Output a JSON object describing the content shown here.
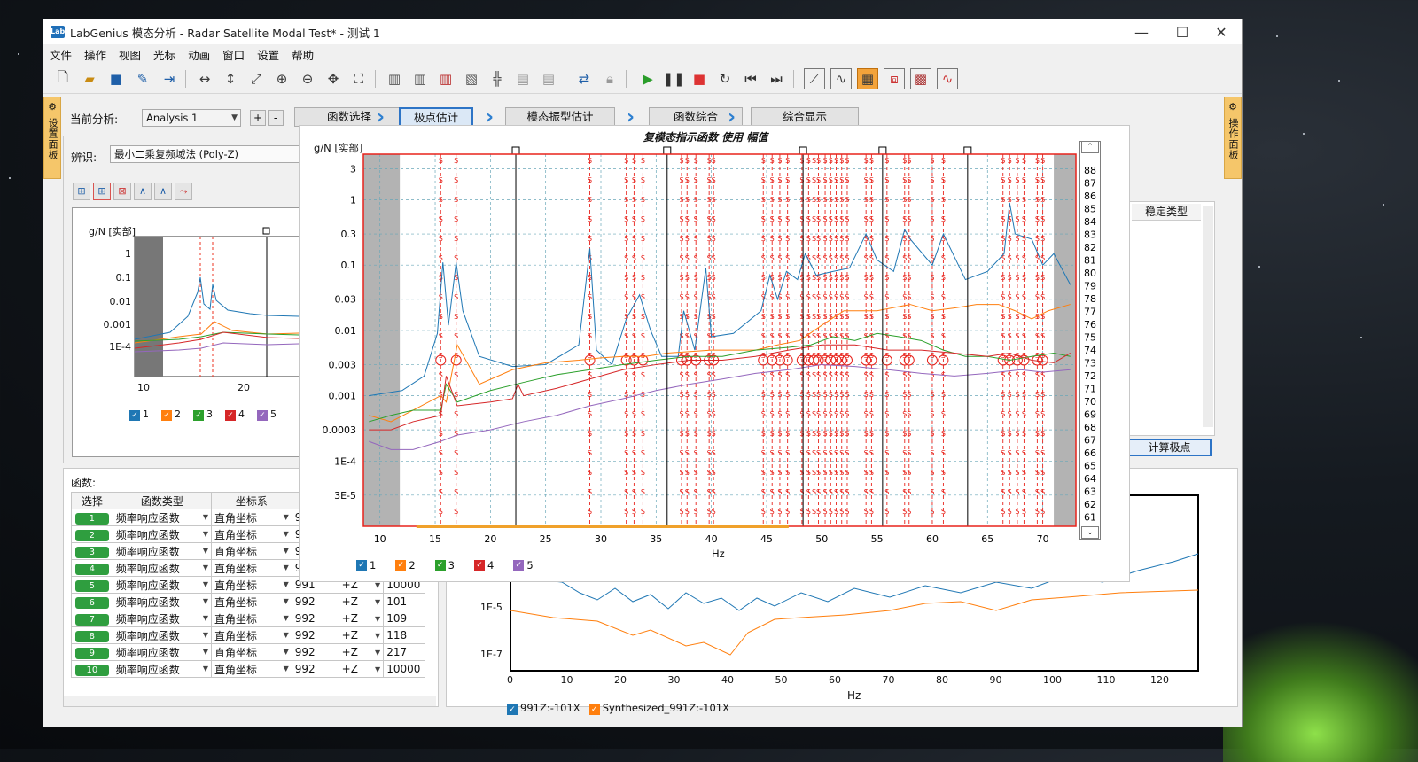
{
  "window": {
    "title": "LabGenius 模态分析 - Radar Satellite Modal Test* - 测试 1",
    "app_icon_text": "Lab",
    "controls": [
      "—",
      "☐",
      "✕"
    ]
  },
  "menu": [
    "文件",
    "操作",
    "视图",
    "光标",
    "动画",
    "窗口",
    "设置",
    "帮助"
  ],
  "toolbar_icons": [
    "new-file-icon",
    "open-folder-icon",
    "save-icon",
    "edit-icon",
    "export-icon",
    "zoom-x-icon",
    "zoom-y-icon",
    "zoom-xy-icon",
    "zoom-in-icon",
    "zoom-out-icon",
    "pan-icon",
    "fit-icon",
    "grid1-icon",
    "grid2-icon",
    "grid3-icon",
    "grid4-icon",
    "grid5-icon",
    "grid6-icon",
    "grid7-icon",
    "link-icon",
    "lock-icon",
    "play-icon",
    "pause-icon",
    "stop-icon",
    "loop-icon",
    "prev-icon",
    "next-icon",
    "view1-icon",
    "view2-icon",
    "view3-icon",
    "view4-icon",
    "view5-icon",
    "view6-icon"
  ],
  "side_tabs": {
    "left": "设置面板",
    "right": "操作面板"
  },
  "workflow": {
    "current_label": "当前分析:",
    "analysis_select": "Analysis 1",
    "plus": "+",
    "minus": "-",
    "steps": [
      "函数选择",
      "极点估计",
      "模态振型估计",
      "函数综合",
      "综合显示"
    ]
  },
  "identification": {
    "label": "辨识:",
    "method": "最小二乘复频域法 (Poly-Z)"
  },
  "right_panel": {
    "column": "稳定类型",
    "button": "计算极点"
  },
  "small_chart": {
    "ylabel": "g/N [实部]",
    "y_ticks": [
      "1",
      "0.1",
      "0.01",
      "0.001",
      "1E-4"
    ],
    "x_ticks": [
      "10",
      "20"
    ],
    "legend": [
      "1",
      "2",
      "3",
      "4",
      "5"
    ]
  },
  "functions": {
    "label": "函数:",
    "headers": [
      "选择",
      "函数类型",
      "坐标系",
      "响"
    ],
    "rows": [
      {
        "n": "1",
        "type": "频率响应函数",
        "coord": "直角坐标",
        "ref": "9",
        "dir": "",
        "count": ""
      },
      {
        "n": "2",
        "type": "频率响应函数",
        "coord": "直角坐标",
        "ref": "9",
        "dir": "",
        "count": ""
      },
      {
        "n": "3",
        "type": "频率响应函数",
        "coord": "直角坐标",
        "ref": "9",
        "dir": "",
        "count": ""
      },
      {
        "n": "4",
        "type": "频率响应函数",
        "coord": "直角坐标",
        "ref": "9",
        "dir": "",
        "count": ""
      },
      {
        "n": "5",
        "type": "频率响应函数",
        "coord": "直角坐标",
        "ref": "991",
        "dir": "+Z",
        "count": "10000"
      },
      {
        "n": "6",
        "type": "频率响应函数",
        "coord": "直角坐标",
        "ref": "992",
        "dir": "+Z",
        "count": "101"
      },
      {
        "n": "7",
        "type": "频率响应函数",
        "coord": "直角坐标",
        "ref": "992",
        "dir": "+Z",
        "count": "109"
      },
      {
        "n": "8",
        "type": "频率响应函数",
        "coord": "直角坐标",
        "ref": "992",
        "dir": "+Z",
        "count": "118"
      },
      {
        "n": "9",
        "type": "频率响应函数",
        "coord": "直角坐标",
        "ref": "992",
        "dir": "+Z",
        "count": "217"
      },
      {
        "n": "10",
        "type": "频率响应函数",
        "coord": "直角坐标",
        "ref": "992",
        "dir": "+Z",
        "count": "10000"
      }
    ]
  },
  "bottom_chart": {
    "y_ticks": [
      "1E-5",
      "1E-7"
    ],
    "x_ticks": [
      "0",
      "10",
      "20",
      "30",
      "40",
      "50",
      "60",
      "70",
      "80",
      "90",
      "100",
      "110",
      "120"
    ],
    "xlabel": "Hz",
    "legend": [
      "991Z:-101X",
      "Synthesized_991Z:-101X"
    ],
    "colors": {
      "measured": "#1f77b4",
      "synth": "#ff7f0e"
    }
  },
  "popup": {
    "title": "复模态指示函数 使用 幅值",
    "ylabel": "g/N [实部]",
    "xlabel": "Hz",
    "y_ticks": [
      "3",
      "1",
      "0.3",
      "0.1",
      "0.03",
      "0.01",
      "0.003",
      "0.001",
      "0.0003",
      "1E-4",
      "3E-5"
    ],
    "x_ticks": [
      "10",
      "15",
      "20",
      "25",
      "30",
      "35",
      "40",
      "45",
      "50",
      "55",
      "60",
      "65",
      "70"
    ],
    "order_labels": [
      "88",
      "87",
      "86",
      "85",
      "84",
      "83",
      "82",
      "81",
      "80",
      "79",
      "78",
      "77",
      "76",
      "75",
      "74",
      "73",
      "72",
      "71",
      "70",
      "69",
      "68",
      "67",
      "66",
      "65",
      "64",
      "63",
      "62",
      "61"
    ],
    "legend": [
      "1",
      "2",
      "3",
      "4",
      "5"
    ],
    "pole_marker": "S"
  },
  "chart_data": {
    "type": "line",
    "title": "复模态指示函数 使用 幅值",
    "xlabel": "Hz",
    "ylabel": "g/N [实部]",
    "xlim": [
      8.5,
      73
    ],
    "ylim": [
      1e-05,
      5
    ],
    "y_scale": "log",
    "grid": true,
    "legend_position": "bottom-left",
    "series_colors": [
      "#1f77b4",
      "#ff7f0e",
      "#2ca02c",
      "#d62728",
      "#9467bd"
    ],
    "series": [
      {
        "name": "1",
        "x": [
          9,
          12,
          14,
          15.2,
          15.7,
          16.2,
          16.9,
          17.5,
          19,
          22,
          25,
          28,
          29,
          29.6,
          31,
          32.3,
          33.5,
          34.5,
          35.5,
          37,
          37.5,
          38.5,
          39.5,
          40,
          42,
          44.5,
          45.3,
          46,
          46.8,
          47.8,
          48.5,
          49.5,
          51,
          52.5,
          54,
          55,
          56.5,
          57.5,
          58,
          60,
          61,
          63,
          65,
          66.5,
          67,
          67.5,
          69,
          70,
          71,
          72.5
        ],
        "y": [
          0.001,
          0.0012,
          0.002,
          0.009,
          0.11,
          0.012,
          0.11,
          0.02,
          0.004,
          0.0028,
          0.003,
          0.006,
          0.18,
          0.005,
          0.003,
          0.015,
          0.035,
          0.01,
          0.004,
          0.004,
          0.02,
          0.005,
          0.09,
          0.008,
          0.009,
          0.02,
          0.07,
          0.03,
          0.08,
          0.06,
          0.15,
          0.07,
          0.08,
          0.09,
          0.3,
          0.12,
          0.08,
          0.35,
          0.25,
          0.1,
          0.3,
          0.06,
          0.08,
          0.15,
          0.9,
          0.3,
          0.25,
          0.1,
          0.15,
          0.05
        ]
      },
      {
        "name": "2",
        "x": [
          9,
          11,
          13,
          15.5,
          16,
          17,
          19,
          22,
          25,
          28,
          30,
          32,
          34,
          36,
          40,
          44,
          46,
          48,
          50,
          52,
          55,
          58,
          60,
          62,
          64,
          66,
          67.5,
          69,
          70.5,
          72.5
        ],
        "y": [
          0.0005,
          0.0004,
          0.0006,
          0.001,
          0.0008,
          0.006,
          0.0015,
          0.0025,
          0.0032,
          0.0035,
          0.0038,
          0.004,
          0.004,
          0.0045,
          0.005,
          0.005,
          0.006,
          0.007,
          0.012,
          0.02,
          0.02,
          0.025,
          0.02,
          0.022,
          0.025,
          0.025,
          0.02,
          0.015,
          0.02,
          0.025
        ]
      },
      {
        "name": "3",
        "x": [
          9,
          11,
          13,
          15.5,
          16,
          17,
          20,
          23,
          26,
          29,
          32,
          35,
          38,
          41,
          44,
          47,
          49,
          51,
          53,
          55,
          57,
          59,
          61,
          63,
          65,
          67,
          69,
          71,
          72.5
        ],
        "y": [
          0.0004,
          0.0005,
          0.0006,
          0.0006,
          0.0015,
          0.0008,
          0.0012,
          0.0016,
          0.0021,
          0.0025,
          0.003,
          0.0035,
          0.004,
          0.004,
          0.005,
          0.0055,
          0.006,
          0.008,
          0.007,
          0.009,
          0.008,
          0.007,
          0.005,
          0.004,
          0.004,
          0.0035,
          0.004,
          0.0045,
          0.004
        ]
      },
      {
        "name": "4",
        "x": [
          9,
          11,
          13,
          15.5,
          16,
          17,
          20,
          22,
          22.5,
          23,
          26,
          29,
          32,
          35,
          38,
          41,
          44,
          47,
          50,
          53,
          56,
          59,
          62,
          65,
          67,
          69,
          71,
          72.5
        ],
        "y": [
          0.0003,
          0.0003,
          0.0004,
          0.0005,
          0.002,
          0.0007,
          0.0008,
          0.0009,
          0.0015,
          0.001,
          0.0013,
          0.0018,
          0.0025,
          0.003,
          0.0035,
          0.0035,
          0.004,
          0.005,
          0.006,
          0.006,
          0.005,
          0.005,
          0.0045,
          0.004,
          0.0045,
          0.0035,
          0.0032,
          0.0045
        ]
      },
      {
        "name": "5",
        "x": [
          9,
          11,
          13,
          15.5,
          17,
          20,
          23,
          26,
          29,
          32,
          35,
          38,
          41,
          44,
          47,
          50,
          53,
          56,
          59,
          62,
          65,
          68,
          70,
          72.5
        ],
        "y": [
          0.0002,
          0.00015,
          0.00015,
          0.0002,
          0.00025,
          0.0003,
          0.0004,
          0.0005,
          0.0007,
          0.0009,
          0.0012,
          0.0015,
          0.0018,
          0.0022,
          0.0025,
          0.003,
          0.0028,
          0.0025,
          0.0022,
          0.002,
          0.0022,
          0.0025,
          0.0023,
          0.0025
        ]
      }
    ],
    "pole_frequencies": [
      15.5,
      16.9,
      29,
      32.3,
      33,
      33.8,
      37.3,
      37.8,
      38.6,
      39.8,
      40.2,
      44.7,
      45.5,
      46.2,
      46.9,
      48.2,
      48.8,
      49.3,
      49.7,
      50.3,
      50.8,
      51.3,
      51.8,
      52.3,
      54,
      54.5,
      55.9,
      57.5,
      57.9,
      60,
      61,
      66.4,
      67,
      67.7,
      68.3,
      69.5,
      70
    ],
    "cursor_frequencies": [
      22.3,
      36,
      48.3,
      55.5,
      63.2
    ]
  }
}
